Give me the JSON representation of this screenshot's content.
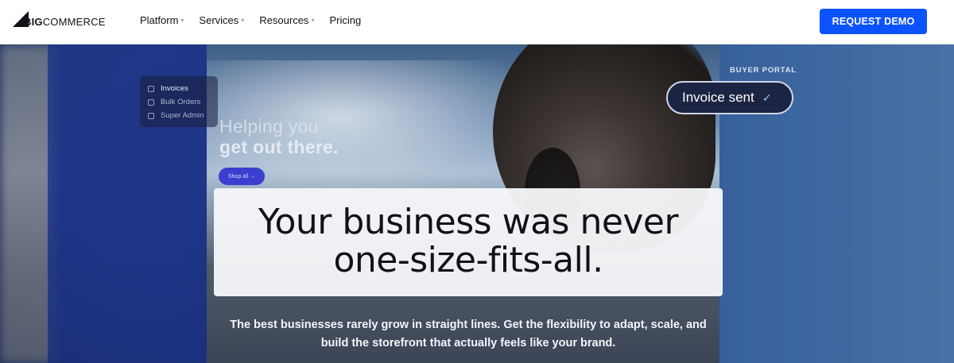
{
  "nav": {
    "logo_big": "BIG",
    "logo_commerce": "COMMERCE",
    "items": [
      {
        "label": "Platform",
        "has_dropdown": true
      },
      {
        "label": "Services",
        "has_dropdown": true
      },
      {
        "label": "Resources",
        "has_dropdown": true
      },
      {
        "label": "Pricing",
        "has_dropdown": false
      }
    ],
    "cta_label": "REQUEST DEMO",
    "cta_color": "#0d52ff"
  },
  "hero": {
    "sidebar": [
      {
        "label": "Invoices",
        "icon": "document-icon"
      },
      {
        "label": "Bulk Orders",
        "icon": "list-icon"
      },
      {
        "label": "Super Admin",
        "icon": "user-icon"
      }
    ],
    "inner_heading_line1": "Helping you",
    "inner_heading_line2": "get out there.",
    "inner_button": "Shop all →",
    "buyer_portal_label": "BUYER PORTAL",
    "invoice_status": "Invoice sent",
    "check_icon": "check-icon",
    "headline_line1": "Your business was never",
    "headline_line2": "one-size-fits-all.",
    "subheadline_line1": "The best businesses rarely grow in straight lines. Get the flexibility to adapt, scale, and",
    "subheadline_line2": "build the storefront that actually feels like your brand."
  }
}
